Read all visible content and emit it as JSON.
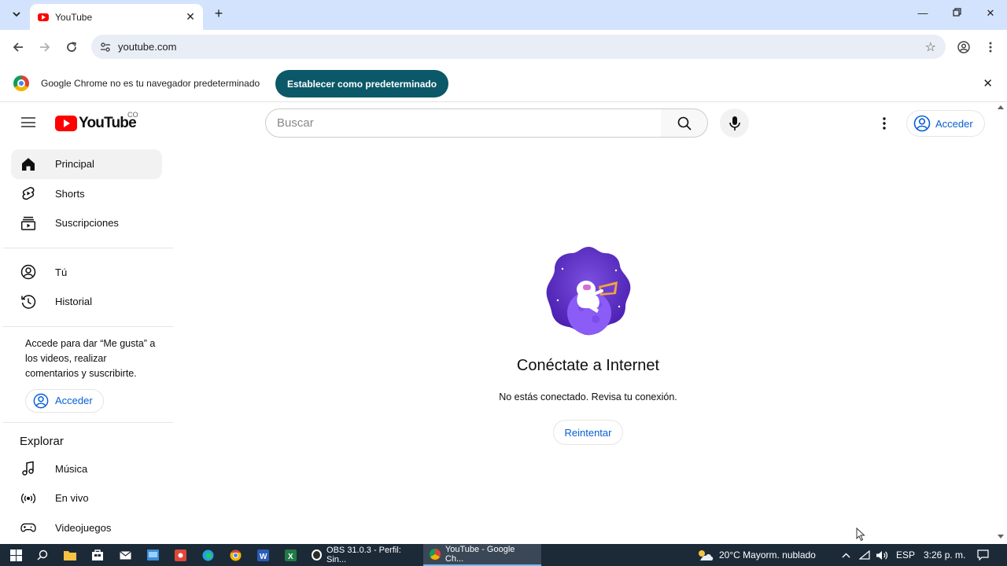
{
  "browser": {
    "tab_title": "YouTube",
    "url": "youtube.com",
    "infobar_text": "Google Chrome no es tu navegador predeterminado",
    "infobar_button": "Establecer como predeterminado"
  },
  "header": {
    "logo_text": "YouTube",
    "country_code": "CO",
    "search_placeholder": "Buscar",
    "signin_label": "Acceder"
  },
  "sidebar": {
    "primary": [
      {
        "label": "Principal",
        "icon": "home-icon"
      },
      {
        "label": "Shorts",
        "icon": "shorts-icon"
      },
      {
        "label": "Suscripciones",
        "icon": "subscriptions-icon"
      }
    ],
    "you": [
      {
        "label": "Tú",
        "icon": "you-icon"
      },
      {
        "label": "Historial",
        "icon": "history-icon"
      }
    ],
    "signin_note": "Accede para dar “Me gusta” a los videos, realizar comentarios y suscribirte.",
    "signin_label": "Acceder",
    "explore_title": "Explorar",
    "explore": [
      {
        "label": "Música",
        "icon": "music-icon"
      },
      {
        "label": "En vivo",
        "icon": "live-icon"
      },
      {
        "label": "Videojuegos",
        "icon": "gaming-icon"
      }
    ]
  },
  "main": {
    "title": "Conéctate a Internet",
    "message": "No estás conectado. Revisa tu conexión.",
    "retry_label": "Reintentar"
  },
  "taskbar": {
    "apps": [
      {
        "label": "OBS 31.0.3 - Perfil: Sin..."
      },
      {
        "label": "YouTube - Google Ch..."
      }
    ],
    "weather": "20°C  Mayorm. nublado",
    "language": "ESP",
    "time": "3:26 p. m."
  },
  "colors": {
    "tabstrip": "#d3e3fd",
    "infobar_button": "#0b5868",
    "youtube_red": "#ff0000",
    "link_blue": "#065fd4",
    "taskbar": "#1c2a38"
  }
}
